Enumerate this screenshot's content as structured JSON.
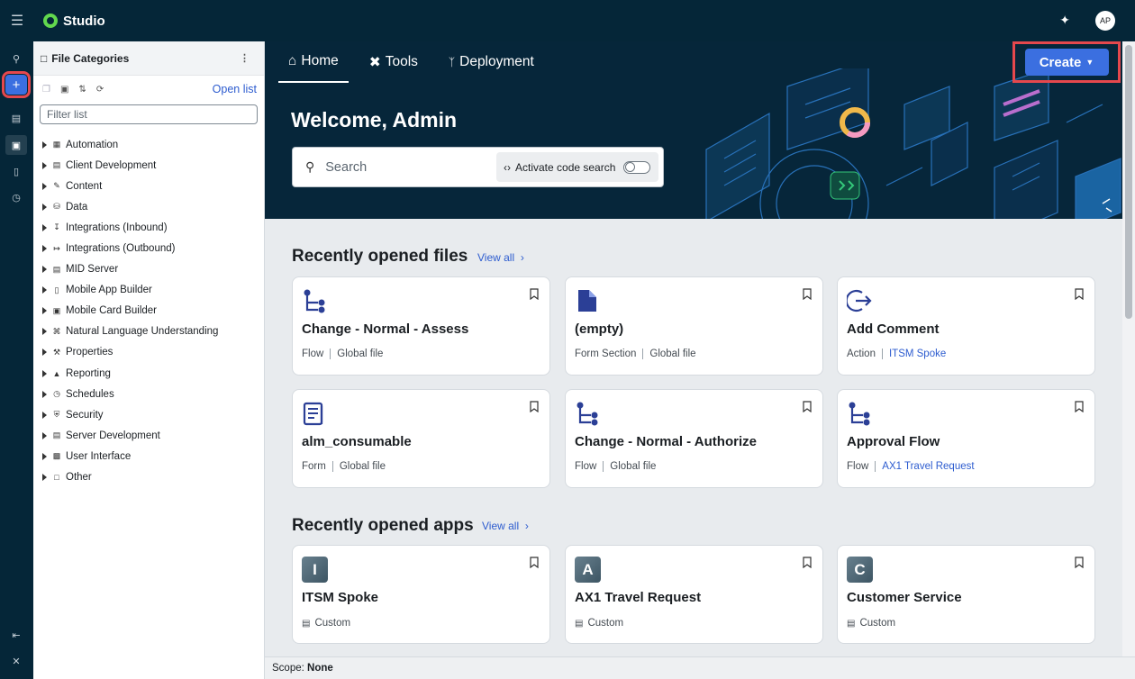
{
  "app": {
    "name": "Studio",
    "avatar_initials": "AP"
  },
  "panel": {
    "title": "File Categories",
    "open_list": "Open list",
    "filter_placeholder": "Filter list",
    "categories": [
      {
        "label": "Automation",
        "icon": "automation-icon"
      },
      {
        "label": "Client Development",
        "icon": "client-development-icon"
      },
      {
        "label": "Content",
        "icon": "content-icon"
      },
      {
        "label": "Data",
        "icon": "database-icon"
      },
      {
        "label": "Integrations (Inbound)",
        "icon": "inbound-icon"
      },
      {
        "label": "Integrations (Outbound)",
        "icon": "outbound-icon"
      },
      {
        "label": "MID Server",
        "icon": "server-icon"
      },
      {
        "label": "Mobile App Builder",
        "icon": "mobile-icon"
      },
      {
        "label": "Mobile Card Builder",
        "icon": "mobile-card-icon"
      },
      {
        "label": "Natural Language Understanding",
        "icon": "nlu-icon"
      },
      {
        "label": "Properties",
        "icon": "wrench-icon"
      },
      {
        "label": "Reporting",
        "icon": "reporting-icon"
      },
      {
        "label": "Schedules",
        "icon": "schedule-icon"
      },
      {
        "label": "Security",
        "icon": "shield-icon"
      },
      {
        "label": "Server Development",
        "icon": "server-dev-icon"
      },
      {
        "label": "User Interface",
        "icon": "ui-icon"
      },
      {
        "label": "Other",
        "icon": "file-icon"
      }
    ]
  },
  "tabs": [
    {
      "label": "Home",
      "icon": "home-icon"
    },
    {
      "label": "Tools",
      "icon": "tools-icon"
    },
    {
      "label": "Deployment",
      "icon": "branch-icon"
    }
  ],
  "create_label": "Create",
  "hero": {
    "welcome": "Welcome, Admin",
    "search_placeholder": "Search",
    "code_search_label": "Activate code search"
  },
  "recent_files": {
    "title": "Recently opened files",
    "view_all": "View all",
    "items": [
      {
        "title": "Change - Normal - Assess",
        "type": "Flow",
        "scope": "Global file",
        "scope_link": false,
        "icon": "flow-icon"
      },
      {
        "title": "(empty)",
        "type": "Form Section",
        "scope": "Global file",
        "scope_link": false,
        "icon": "document-icon"
      },
      {
        "title": "Add Comment",
        "type": "Action",
        "scope": "ITSM Spoke",
        "scope_link": true,
        "icon": "action-icon"
      },
      {
        "title": "alm_consumable",
        "type": "Form",
        "scope": "Global file",
        "scope_link": false,
        "icon": "form-icon"
      },
      {
        "title": "Change - Normal - Authorize",
        "type": "Flow",
        "scope": "Global file",
        "scope_link": false,
        "icon": "flow-icon"
      },
      {
        "title": "Approval Flow",
        "type": "Flow",
        "scope": "AX1 Travel Request",
        "scope_link": true,
        "icon": "flow-icon"
      }
    ]
  },
  "recent_apps": {
    "title": "Recently opened apps",
    "view_all": "View all",
    "items": [
      {
        "letter": "I",
        "title": "ITSM Spoke",
        "type": "Custom"
      },
      {
        "letter": "A",
        "title": "AX1 Travel Request",
        "type": "Custom"
      },
      {
        "letter": "C",
        "title": "Customer Service",
        "type": "Custom"
      }
    ]
  },
  "status": {
    "scope_label": "Scope:",
    "scope_value": "None"
  },
  "colors": {
    "accent": "#3b6fe0",
    "nav_bg": "#052638",
    "highlight": "#e5484d",
    "icon_blue": "#2b3f96"
  }
}
